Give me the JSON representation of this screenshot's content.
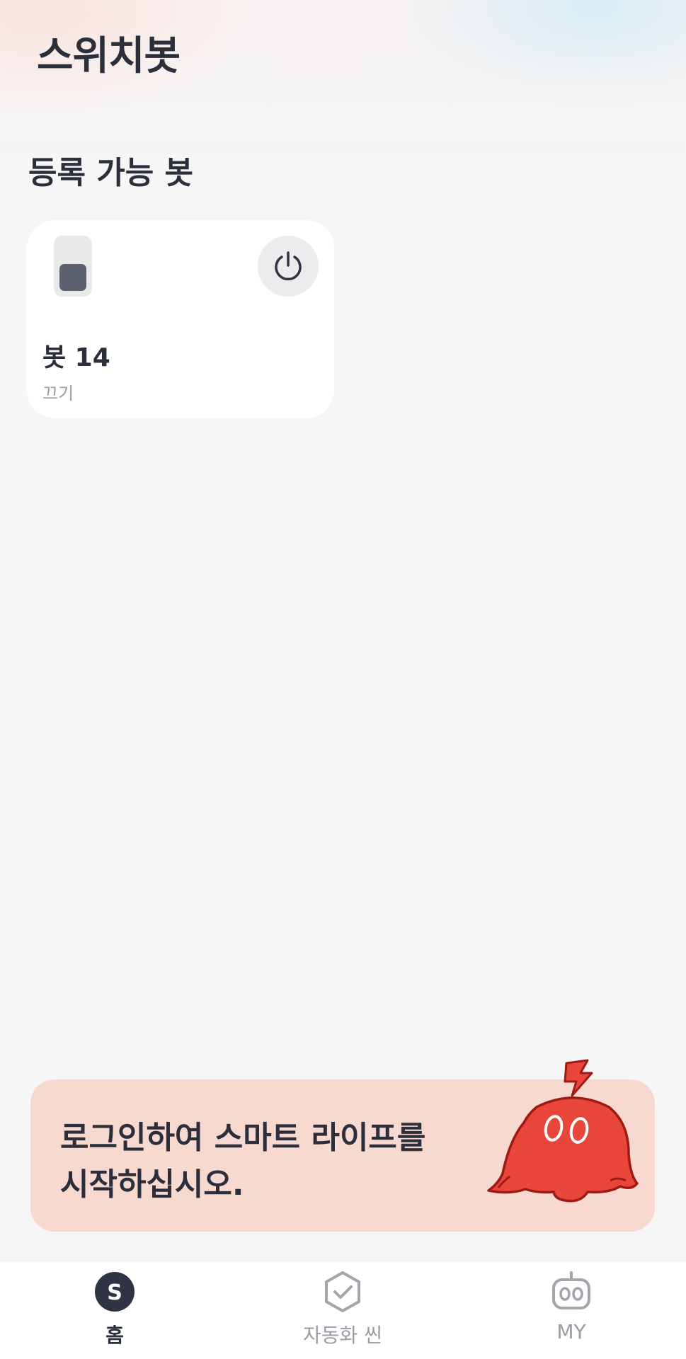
{
  "app": {
    "title": "스위치봇"
  },
  "sections": {
    "available_bots_title": "등록 가능 봇"
  },
  "bot_card": {
    "name": "봇 14",
    "status": "끄기",
    "icons": {
      "device": "switch-device-icon",
      "action": "power-icon"
    }
  },
  "login_banner": {
    "text": "로그인하여 스마트 라이프를\n시작하십시오.",
    "mascot": "red-bot-mascot-icon"
  },
  "bottom_nav": {
    "items": [
      {
        "label": "홈",
        "icon": "home-s-icon",
        "active": true
      },
      {
        "label": "자동화 씬",
        "icon": "hexagon-check-icon",
        "active": false
      },
      {
        "label": "MY",
        "icon": "robot-face-icon",
        "active": false
      }
    ]
  },
  "colors": {
    "accent_dark": "#2b2e3b",
    "banner_bg": "#f8d9d0",
    "mascot_red": "#e8463a"
  }
}
